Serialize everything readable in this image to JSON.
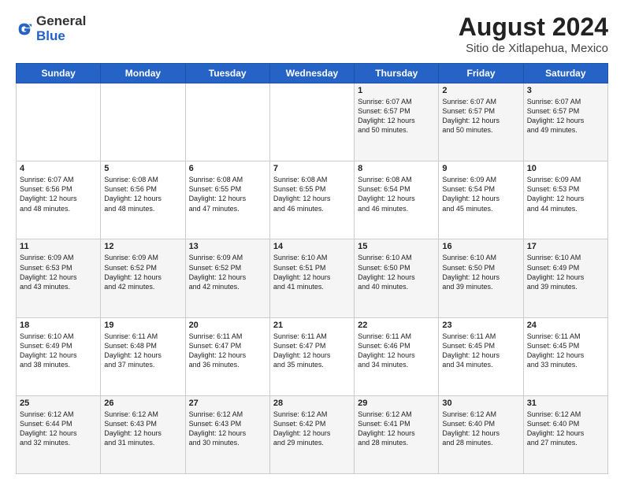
{
  "header": {
    "logo_general": "General",
    "logo_blue": "Blue",
    "month_year": "August 2024",
    "subtitle": "Sitio de Xitlapehua, Mexico"
  },
  "days_of_week": [
    "Sunday",
    "Monday",
    "Tuesday",
    "Wednesday",
    "Thursday",
    "Friday",
    "Saturday"
  ],
  "weeks": [
    [
      {
        "day": "",
        "empty": true
      },
      {
        "day": "",
        "empty": true
      },
      {
        "day": "",
        "empty": true
      },
      {
        "day": "",
        "empty": true
      },
      {
        "day": "1",
        "sunrise": "6:07 AM",
        "sunset": "6:57 PM",
        "daylight": "12 hours and 50 minutes."
      },
      {
        "day": "2",
        "sunrise": "6:07 AM",
        "sunset": "6:57 PM",
        "daylight": "12 hours and 50 minutes."
      },
      {
        "day": "3",
        "sunrise": "6:07 AM",
        "sunset": "6:57 PM",
        "daylight": "12 hours and 49 minutes."
      }
    ],
    [
      {
        "day": "4",
        "sunrise": "6:07 AM",
        "sunset": "6:56 PM",
        "daylight": "12 hours and 48 minutes."
      },
      {
        "day": "5",
        "sunrise": "6:08 AM",
        "sunset": "6:56 PM",
        "daylight": "12 hours and 48 minutes."
      },
      {
        "day": "6",
        "sunrise": "6:08 AM",
        "sunset": "6:55 PM",
        "daylight": "12 hours and 47 minutes."
      },
      {
        "day": "7",
        "sunrise": "6:08 AM",
        "sunset": "6:55 PM",
        "daylight": "12 hours and 46 minutes."
      },
      {
        "day": "8",
        "sunrise": "6:08 AM",
        "sunset": "6:54 PM",
        "daylight": "12 hours and 46 minutes."
      },
      {
        "day": "9",
        "sunrise": "6:09 AM",
        "sunset": "6:54 PM",
        "daylight": "12 hours and 45 minutes."
      },
      {
        "day": "10",
        "sunrise": "6:09 AM",
        "sunset": "6:53 PM",
        "daylight": "12 hours and 44 minutes."
      }
    ],
    [
      {
        "day": "11",
        "sunrise": "6:09 AM",
        "sunset": "6:53 PM",
        "daylight": "12 hours and 43 minutes."
      },
      {
        "day": "12",
        "sunrise": "6:09 AM",
        "sunset": "6:52 PM",
        "daylight": "12 hours and 42 minutes."
      },
      {
        "day": "13",
        "sunrise": "6:09 AM",
        "sunset": "6:52 PM",
        "daylight": "12 hours and 42 minutes."
      },
      {
        "day": "14",
        "sunrise": "6:10 AM",
        "sunset": "6:51 PM",
        "daylight": "12 hours and 41 minutes."
      },
      {
        "day": "15",
        "sunrise": "6:10 AM",
        "sunset": "6:50 PM",
        "daylight": "12 hours and 40 minutes."
      },
      {
        "day": "16",
        "sunrise": "6:10 AM",
        "sunset": "6:50 PM",
        "daylight": "12 hours and 39 minutes."
      },
      {
        "day": "17",
        "sunrise": "6:10 AM",
        "sunset": "6:49 PM",
        "daylight": "12 hours and 39 minutes."
      }
    ],
    [
      {
        "day": "18",
        "sunrise": "6:10 AM",
        "sunset": "6:49 PM",
        "daylight": "12 hours and 38 minutes."
      },
      {
        "day": "19",
        "sunrise": "6:11 AM",
        "sunset": "6:48 PM",
        "daylight": "12 hours and 37 minutes."
      },
      {
        "day": "20",
        "sunrise": "6:11 AM",
        "sunset": "6:47 PM",
        "daylight": "12 hours and 36 minutes."
      },
      {
        "day": "21",
        "sunrise": "6:11 AM",
        "sunset": "6:47 PM",
        "daylight": "12 hours and 35 minutes."
      },
      {
        "day": "22",
        "sunrise": "6:11 AM",
        "sunset": "6:46 PM",
        "daylight": "12 hours and 34 minutes."
      },
      {
        "day": "23",
        "sunrise": "6:11 AM",
        "sunset": "6:45 PM",
        "daylight": "12 hours and 34 minutes."
      },
      {
        "day": "24",
        "sunrise": "6:11 AM",
        "sunset": "6:45 PM",
        "daylight": "12 hours and 33 minutes."
      }
    ],
    [
      {
        "day": "25",
        "sunrise": "6:12 AM",
        "sunset": "6:44 PM",
        "daylight": "12 hours and 32 minutes."
      },
      {
        "day": "26",
        "sunrise": "6:12 AM",
        "sunset": "6:43 PM",
        "daylight": "12 hours and 31 minutes."
      },
      {
        "day": "27",
        "sunrise": "6:12 AM",
        "sunset": "6:43 PM",
        "daylight": "12 hours and 30 minutes."
      },
      {
        "day": "28",
        "sunrise": "6:12 AM",
        "sunset": "6:42 PM",
        "daylight": "12 hours and 29 minutes."
      },
      {
        "day": "29",
        "sunrise": "6:12 AM",
        "sunset": "6:41 PM",
        "daylight": "12 hours and 28 minutes."
      },
      {
        "day": "30",
        "sunrise": "6:12 AM",
        "sunset": "6:40 PM",
        "daylight": "12 hours and 28 minutes."
      },
      {
        "day": "31",
        "sunrise": "6:12 AM",
        "sunset": "6:40 PM",
        "daylight": "12 hours and 27 minutes."
      }
    ]
  ]
}
